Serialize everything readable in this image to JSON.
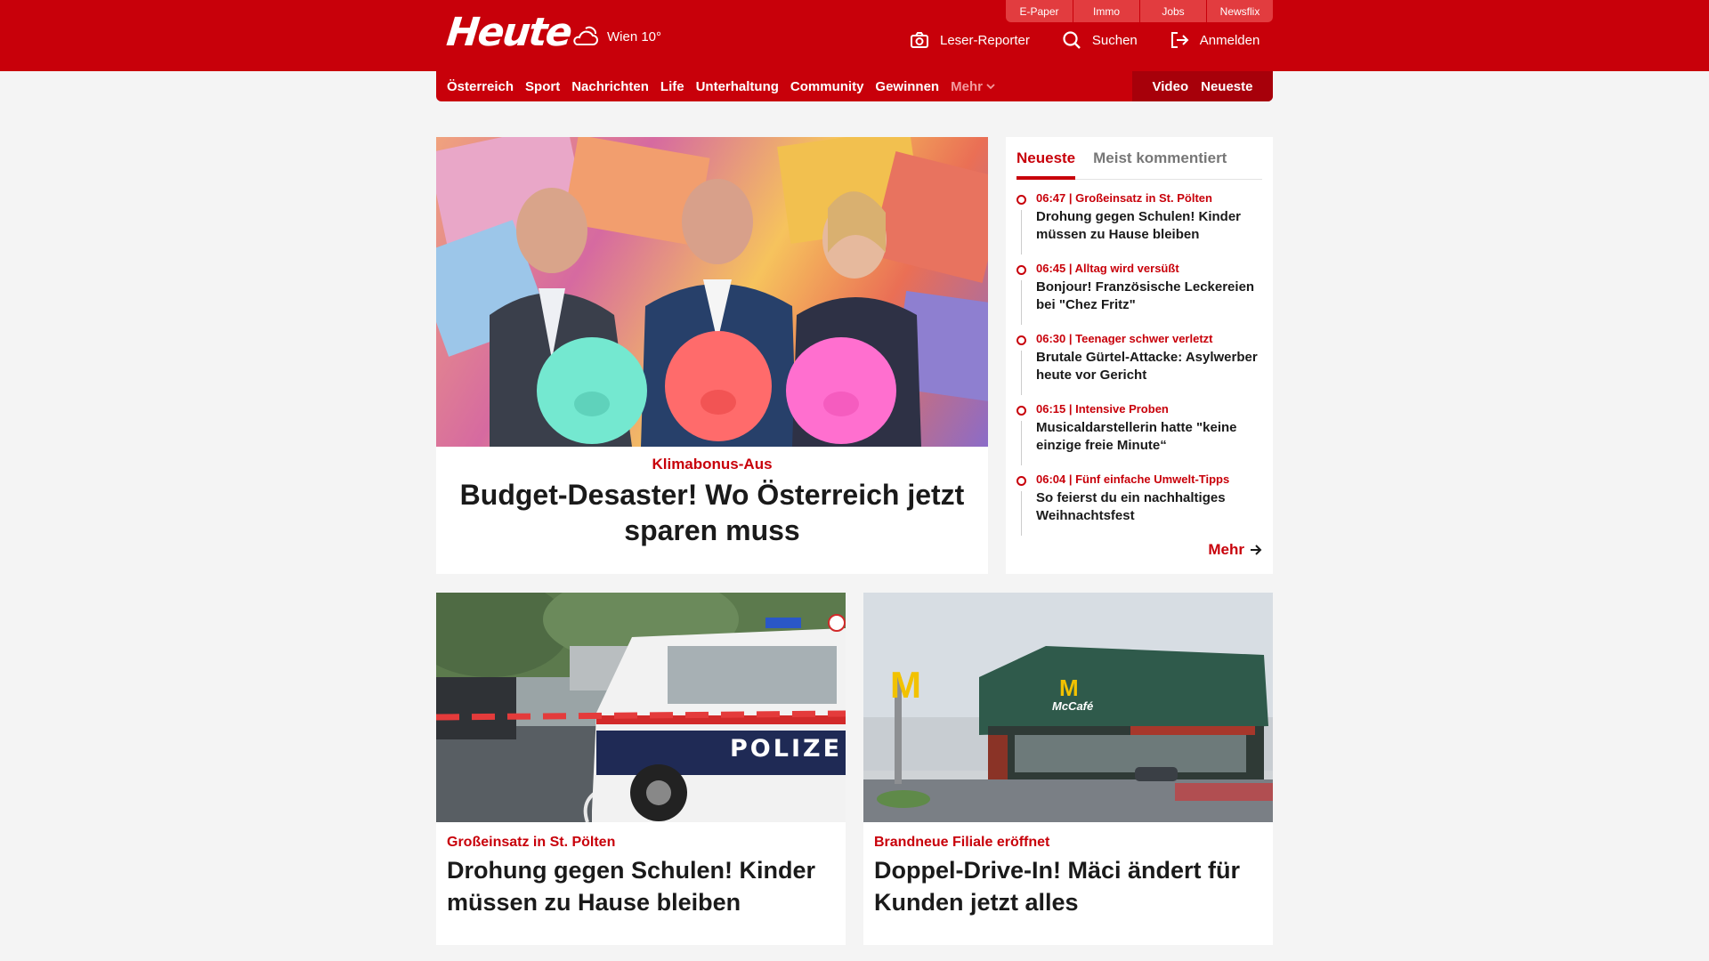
{
  "brand": {
    "logo": "Heute",
    "weather": "Wien 10°"
  },
  "service_tabs": [
    "E-Paper",
    "Immo",
    "Jobs",
    "Newsflix"
  ],
  "header_actions": {
    "reporter": "Leser-Reporter",
    "search": "Suchen",
    "login": "Anmelden"
  },
  "nav": {
    "items": [
      "Österreich",
      "Sport",
      "Nachrichten",
      "Life",
      "Unterhaltung",
      "Community",
      "Gewinnen"
    ],
    "more": "Mehr",
    "right": [
      "Video",
      "Neueste"
    ]
  },
  "hero": {
    "kicker": "Klimabonus-Aus",
    "title": "Budget-Desaster! Wo Österreich jetzt sparen muss"
  },
  "sidebar": {
    "tabs": [
      "Neueste",
      "Meist kommentiert"
    ],
    "items": [
      {
        "meta": "06:47 | Großeinsatz in St. Pölten",
        "title": "Drohung gegen Schulen! Kinder müssen zu Hause bleiben"
      },
      {
        "meta": "06:45 | Alltag wird versüßt",
        "title": "Bonjour! Französische Leckereien bei \"Chez Fritz\""
      },
      {
        "meta": "06:30 | Teenager schwer verletzt",
        "title": "Brutale Gürtel-Attacke: Asylwerber heute vor Gericht"
      },
      {
        "meta": "06:15 | Intensive Proben",
        "title": "Musicaldarstellerin hatte \"keine einzige freie Minute“"
      },
      {
        "meta": "06:04 | Fünf einfache Umwelt-Tipps",
        "title": "So feierst du ein nachhaltiges Weihnachtsfest"
      }
    ],
    "more": "Mehr"
  },
  "cards": [
    {
      "kicker": "Großeinsatz in St. Pölten",
      "title": "Drohung gegen Schulen! Kinder müssen zu Hause bleiben",
      "img_text": "POLIZE"
    },
    {
      "kicker": "Brandneue Filiale eröffnet",
      "title": "Doppel-Drive-In! Mäci ändert für Kunden jetzt alles",
      "img_text": "McCafé"
    }
  ],
  "colors": {
    "brand": "#c8000a",
    "brand_dark": "#a7000a",
    "background": "#f4f4f4"
  }
}
